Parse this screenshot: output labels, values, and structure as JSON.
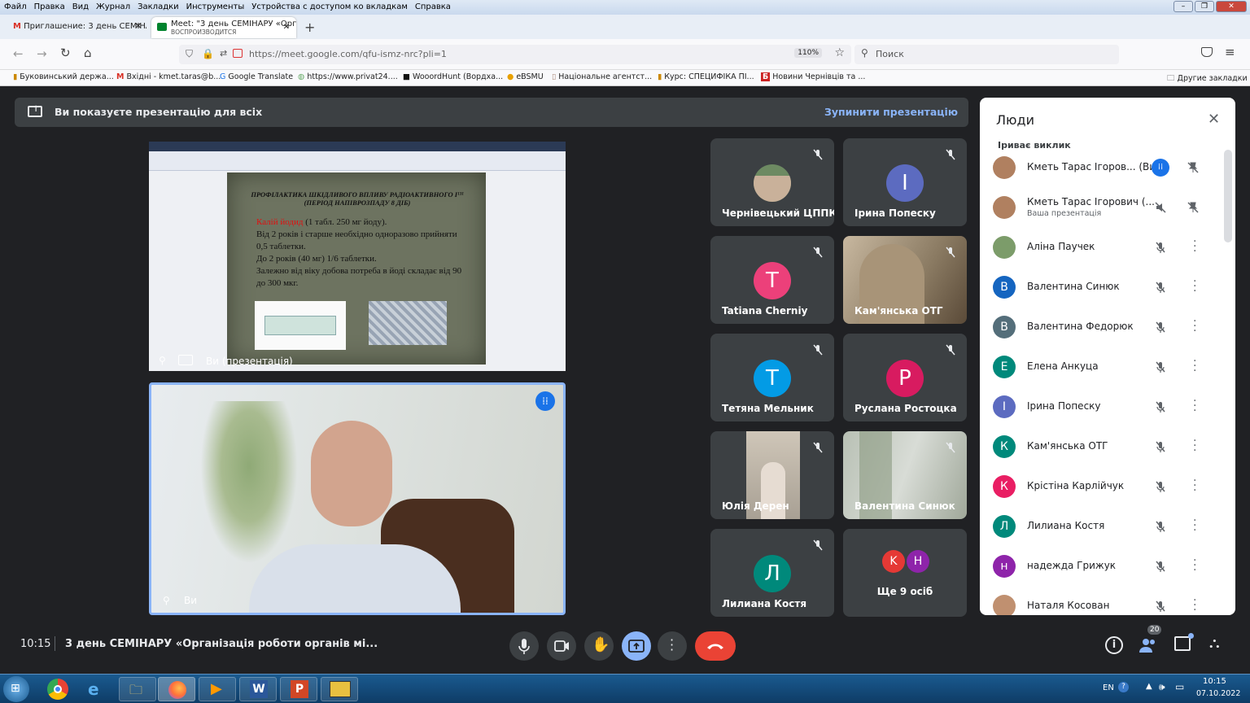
{
  "menubar": {
    "items": [
      "Файл",
      "Правка",
      "Вид",
      "Журнал",
      "Закладки",
      "Инструменты",
      "Устройства с доступом ко вкладкам",
      "Справка"
    ]
  },
  "tabs": [
    {
      "label": "Приглашение: 3 день СЕМІНА"
    },
    {
      "label": "Meet: \"3 день СЕМІНАРУ «Орг",
      "sub": "ВОСПРОИЗВОДИТСЯ"
    }
  ],
  "nav": {
    "url": "https://meet.google.com/qfu-ismz-nrc?pli=1",
    "zoom": "110%",
    "search_placeholder": "Поиск"
  },
  "bookmarks": [
    "Буковинський держа...",
    "Вхідні - kmet.taras@b...",
    "Google Translate",
    "https://www.privat24....",
    "WooordHunt (Вордха...",
    "eBSMU",
    "Національне агентст...",
    "Курс: СПЕЦИФІКА ПІ...",
    "Новини Чернівців та ...",
    "Другие закладки"
  ],
  "presenting": {
    "text": "Ви показуєте презентацію для всіх",
    "stop": "Зупинити презентацію"
  },
  "slide": {
    "title": "ПРОФІЛАКТИКА ШКІДЛИВОГО ВПЛИВУ РАДІОАКТИВНОГО I¹³¹ (ПЕРІОД НАПІВРОЗПАДУ 8 ДІБ)",
    "drug": "Калій йодид",
    "line1": " (1 табл. 250 мг йоду).",
    "line2": "Від 2 років і старше необхідно одноразово прийняти 0,5 таблетки.",
    "line3": "До 2 років (40 мг) 1/6 таблетки.",
    "line4": "Залежно від віку добова потреба в йоді складає від 90 до 300 мкг.",
    "label": "Ви (презентація)"
  },
  "self_label": "Ви",
  "tiles": [
    {
      "name": "Чернівецький ЦППК",
      "initial": "",
      "color": "#5f7a5a"
    },
    {
      "name": "Ірина Попеску",
      "initial": "I",
      "color": "#5c6bc0"
    },
    {
      "name": "Tatiana Cherniy",
      "initial": "T",
      "color": "#ec407a"
    },
    {
      "name": "Кам'янська ОТГ",
      "initial": "",
      "color": "#8a7a60"
    },
    {
      "name": "Тетяна Мельник",
      "initial": "T",
      "color": "#039be5"
    },
    {
      "name": "Руслана Ростоцка",
      "initial": "P",
      "color": "#d81b60"
    },
    {
      "name": "Юлія Дерен",
      "initial": "",
      "color": "#a89a8a"
    },
    {
      "name": "Валентина Синюк",
      "initial": "",
      "color": "#9aa598"
    },
    {
      "name": "Лилиана Костя",
      "initial": "Л",
      "color": "#00897b"
    },
    {
      "name": "Ще 9 осіб",
      "initial": "",
      "color": "#3c4043"
    }
  ],
  "more_avatars": [
    {
      "initial": "K",
      "color": "#e53935"
    },
    {
      "initial": "Н",
      "color": "#8e24aa"
    }
  ],
  "people": {
    "title": "Люди",
    "section": "Іриває виклик",
    "list": [
      {
        "name": "Кметь Тарас Ігоров... (Ви)",
        "sub": "",
        "initial": "",
        "color": "#b08060"
      },
      {
        "name": "Кметь Тарас Ігорович (...",
        "sub": "Ваша презентація",
        "initial": "",
        "color": "#b08060"
      },
      {
        "name": "Аліна Паучек",
        "sub": "",
        "initial": "",
        "color": "#7c9c6a"
      },
      {
        "name": "Валентина Синюк",
        "sub": "",
        "initial": "В",
        "color": "#1565c0"
      },
      {
        "name": "Валентина Федорюк",
        "sub": "",
        "initial": "В",
        "color": "#546e7a"
      },
      {
        "name": "Елена Анкуца",
        "sub": "",
        "initial": "Е",
        "color": "#00897b"
      },
      {
        "name": "Ірина Попеску",
        "sub": "",
        "initial": "I",
        "color": "#5c6bc0"
      },
      {
        "name": "Кам'янська ОТГ",
        "sub": "",
        "initial": "К",
        "color": "#00897b"
      },
      {
        "name": "Крістіна Карлійчук",
        "sub": "",
        "initial": "К",
        "color": "#e91e63"
      },
      {
        "name": "Лилиана Костя",
        "sub": "",
        "initial": "Л",
        "color": "#00897b"
      },
      {
        "name": "надежда Грижук",
        "sub": "",
        "initial": "н",
        "color": "#8e24aa"
      },
      {
        "name": "Наталя Косован",
        "sub": "",
        "initial": "",
        "color": "#c09070"
      }
    ]
  },
  "bottom": {
    "time": "10:15",
    "title": "3 день СЕМІНАРУ «Організація роботи органів мі...",
    "people_count": "20"
  },
  "taskbar": {
    "lang": "EN",
    "clock_time": "10:15",
    "clock_date": "07.10.2022"
  }
}
